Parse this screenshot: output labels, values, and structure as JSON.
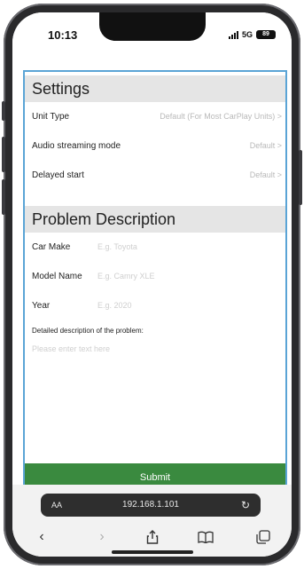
{
  "status_bar": {
    "time": "10:13",
    "network": "5G",
    "battery": "89"
  },
  "settings": {
    "title": "Settings",
    "rows": [
      {
        "label": "Unit Type",
        "value": "Default (For Most CarPlay Units) >"
      },
      {
        "label": "Audio streaming mode",
        "value": "Default >"
      },
      {
        "label": "Delayed start",
        "value": "Default >"
      }
    ]
  },
  "problem": {
    "title": "Problem Description",
    "fields": [
      {
        "label": "Car Make",
        "placeholder": "E.g. Toyota"
      },
      {
        "label": "Model Name",
        "placeholder": "E.g. Camry XLE"
      },
      {
        "label": "Year",
        "placeholder": "E.g. 2020"
      }
    ],
    "description_label": "Detailed description of the problem:",
    "description_placeholder": "Please enter text here"
  },
  "submit_label": "Submit",
  "browser": {
    "text_size_label": "AA",
    "url": "192.168.1.101"
  },
  "icons": {
    "reload": "reload-icon",
    "back": "back-icon",
    "forward": "forward-icon",
    "share": "share-icon",
    "bookmarks": "bookmarks-icon",
    "tabs": "tabs-icon"
  }
}
